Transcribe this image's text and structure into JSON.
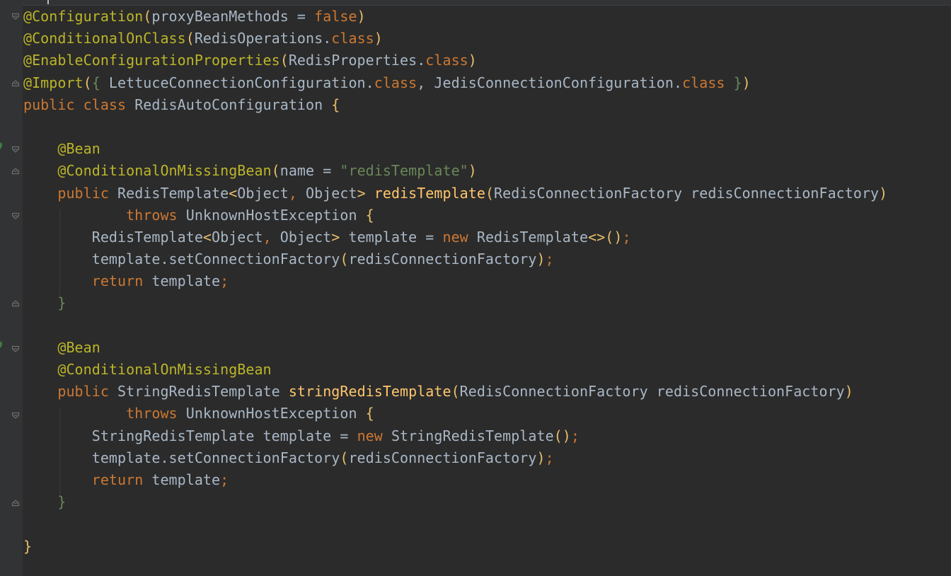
{
  "editor": {
    "lines": [
      {
        "parts": [
          [
            "ann",
            "@Configuration"
          ],
          [
            "br1",
            "("
          ],
          [
            "pn",
            "proxyBeanMethods = "
          ],
          [
            "kw",
            "false"
          ],
          [
            "br1",
            ")"
          ]
        ]
      },
      {
        "parts": [
          [
            "ann",
            "@ConditionalOnClass"
          ],
          [
            "br1",
            "("
          ],
          [
            "pn",
            "RedisOperations."
          ],
          [
            "kw",
            "class"
          ],
          [
            "br1",
            ")"
          ]
        ]
      },
      {
        "parts": [
          [
            "ann",
            "@EnableConfigurationProperties"
          ],
          [
            "br1",
            "("
          ],
          [
            "pn",
            "RedisProperties."
          ],
          [
            "kw",
            "class"
          ],
          [
            "br1",
            ")"
          ]
        ]
      },
      {
        "parts": [
          [
            "ann",
            "@Import"
          ],
          [
            "br1",
            "("
          ],
          [
            "grn",
            "{ "
          ],
          [
            "pn",
            "LettuceConnectionConfiguration."
          ],
          [
            "kw",
            "class"
          ],
          [
            "pn",
            ", JedisConnectionConfiguration."
          ],
          [
            "kw",
            "class "
          ],
          [
            "grn",
            "}"
          ],
          [
            "br1",
            ")"
          ]
        ]
      },
      {
        "parts": [
          [
            "kw",
            "public class "
          ],
          [
            "pn",
            "RedisAutoConfiguration "
          ],
          [
            "br1",
            "{"
          ]
        ]
      },
      {
        "parts": []
      },
      {
        "parts": [
          [
            "pn",
            "    "
          ],
          [
            "ann",
            "@Bean"
          ]
        ]
      },
      {
        "parts": [
          [
            "pn",
            "    "
          ],
          [
            "ann",
            "@ConditionalOnMissingBean"
          ],
          [
            "br1",
            "("
          ],
          [
            "pn",
            "name = "
          ],
          [
            "str",
            "\"redisTemplate\""
          ],
          [
            "br1",
            ")"
          ]
        ]
      },
      {
        "parts": [
          [
            "pn",
            "    "
          ],
          [
            "kw",
            "public "
          ],
          [
            "pn",
            "RedisTemplate"
          ],
          [
            "br1",
            "<"
          ],
          [
            "pn",
            "Object"
          ],
          [
            "kw",
            ", "
          ],
          [
            "pn",
            "Object"
          ],
          [
            "br1",
            "> "
          ],
          [
            "fn",
            "redisTemplate"
          ],
          [
            "br1",
            "("
          ],
          [
            "pn",
            "RedisConnectionFactory redisConnectionFactory"
          ],
          [
            "br1",
            ")"
          ]
        ]
      },
      {
        "parts": [
          [
            "pn",
            "            "
          ],
          [
            "kw",
            "throws "
          ],
          [
            "pn",
            "UnknownHostException "
          ],
          [
            "br1",
            "{"
          ]
        ]
      },
      {
        "parts": [
          [
            "pn",
            "        RedisTemplate"
          ],
          [
            "br1",
            "<"
          ],
          [
            "pn",
            "Object"
          ],
          [
            "kw",
            ", "
          ],
          [
            "pn",
            "Object"
          ],
          [
            "br1",
            "> "
          ],
          [
            "pn",
            "template = "
          ],
          [
            "kw",
            "new "
          ],
          [
            "pn",
            "RedisTemplate"
          ],
          [
            "br1",
            "<>()"
          ],
          [
            "kw",
            ";"
          ]
        ]
      },
      {
        "parts": [
          [
            "pn",
            "        template.setConnectionFactory"
          ],
          [
            "br1",
            "("
          ],
          [
            "pn",
            "redisConnectionFactory"
          ],
          [
            "br1",
            ")"
          ],
          [
            "kw",
            ";"
          ]
        ]
      },
      {
        "parts": [
          [
            "pn",
            "        "
          ],
          [
            "kw",
            "return "
          ],
          [
            "pn",
            "template"
          ],
          [
            "kw",
            ";"
          ]
        ]
      },
      {
        "parts": [
          [
            "pn",
            "    "
          ],
          [
            "grn",
            "}"
          ]
        ]
      },
      {
        "parts": []
      },
      {
        "parts": [
          [
            "pn",
            "    "
          ],
          [
            "ann",
            "@Bean"
          ]
        ]
      },
      {
        "parts": [
          [
            "pn",
            "    "
          ],
          [
            "ann",
            "@ConditionalOnMissingBean"
          ]
        ]
      },
      {
        "parts": [
          [
            "pn",
            "    "
          ],
          [
            "kw",
            "public "
          ],
          [
            "pn",
            "StringRedisTemplate "
          ],
          [
            "fn",
            "stringRedisTemplate"
          ],
          [
            "br1",
            "("
          ],
          [
            "pn",
            "RedisConnectionFactory redisConnectionFactory"
          ],
          [
            "br1",
            ")"
          ]
        ]
      },
      {
        "parts": [
          [
            "pn",
            "            "
          ],
          [
            "kw",
            "throws "
          ],
          [
            "pn",
            "UnknownHostException "
          ],
          [
            "br1",
            "{"
          ]
        ]
      },
      {
        "parts": [
          [
            "pn",
            "        StringRedisTemplate template = "
          ],
          [
            "kw",
            "new "
          ],
          [
            "pn",
            "StringRedisTemplate"
          ],
          [
            "br1",
            "()"
          ],
          [
            "kw",
            ";"
          ]
        ]
      },
      {
        "parts": [
          [
            "pn",
            "        template.setConnectionFactory"
          ],
          [
            "br1",
            "("
          ],
          [
            "pn",
            "redisConnectionFactory"
          ],
          [
            "br1",
            ")"
          ],
          [
            "kw",
            ";"
          ]
        ]
      },
      {
        "parts": [
          [
            "pn",
            "        "
          ],
          [
            "kw",
            "return "
          ],
          [
            "pn",
            "template"
          ],
          [
            "kw",
            ";"
          ]
        ]
      },
      {
        "parts": [
          [
            "pn",
            "    "
          ],
          [
            "grn",
            "}"
          ]
        ]
      },
      {
        "parts": []
      },
      {
        "parts": [
          [
            "br1",
            "}"
          ]
        ]
      }
    ],
    "colors": {
      "background": "#2b2b2b",
      "annotation": "#bbb529",
      "keyword": "#cc7832",
      "string": "#6a8759",
      "method": "#ffc66d",
      "plain": "#a9b7c6"
    }
  },
  "gutter": {
    "fold_icons": [
      "fold-open-icon",
      "fold-close-icon",
      "bean-icon"
    ]
  }
}
